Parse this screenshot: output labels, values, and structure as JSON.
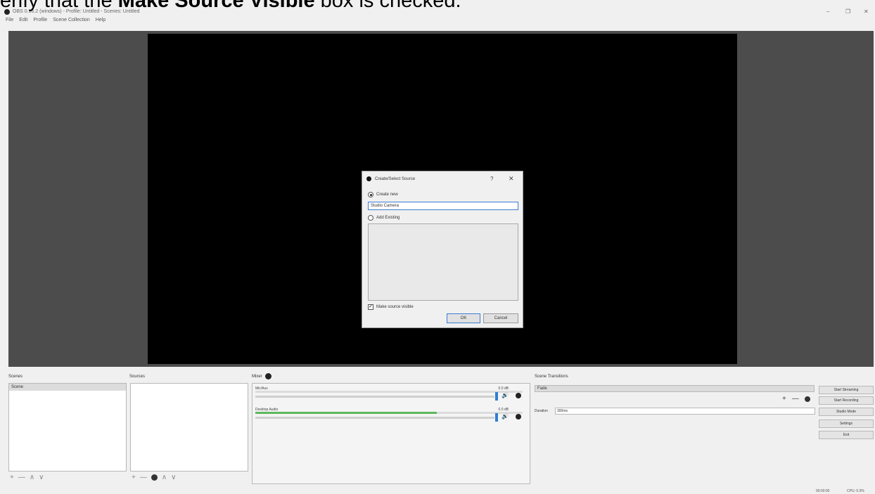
{
  "caption": {
    "prefix": "erify that the ",
    "bold": "Make Source Visible",
    "suffix": " box is checked."
  },
  "window": {
    "title": "OBS 0.16.2 (windows) - Profile: Untitled - Scenes: Untitled",
    "menu": [
      "File",
      "Edit",
      "Profile",
      "Scene Collection",
      "Help"
    ],
    "controls": {
      "minimize": "–",
      "restore": "❐",
      "close": "✕"
    }
  },
  "dialog": {
    "title": "Create/Select Source",
    "help": "?",
    "close": "✕",
    "create_new_label": "Create new",
    "create_new_selected": true,
    "name_value": "Studio Camera",
    "add_existing_label": "Add Existing",
    "make_visible_label": "Make source visible",
    "make_visible_checked": true,
    "ok_label": "OK",
    "cancel_label": "Cancel"
  },
  "docks": {
    "scenes": {
      "title": "Scenes",
      "items": [
        "Scene"
      ]
    },
    "sources": {
      "title": "Sources"
    },
    "mixer": {
      "title": "Mixer",
      "channels": [
        {
          "name": "Mic/Aux",
          "db": "0.0 dB",
          "level": 0.0
        },
        {
          "name": "Desktop Audio",
          "db": "0.0 dB",
          "level": 0.68
        }
      ]
    },
    "transitions": {
      "title": "Scene Transitions",
      "selected": "Fade",
      "duration_label": "Duration",
      "duration_value": "300ms"
    },
    "controls": [
      "Start Streaming",
      "Start Recording",
      "Studio Mode",
      "Settings",
      "Exit"
    ]
  },
  "status": {
    "time": "00:00:00",
    "cpu": "CPU: 0.3%"
  },
  "icons": {
    "add": "+",
    "remove": "—",
    "up": "∧",
    "down": "∨",
    "speaker": "🔊"
  },
  "colors": {
    "preview_bg": "#4c4c4c",
    "canvas_bg": "#000000",
    "accent": "#2f7dd1",
    "meter": "#5cb85c"
  }
}
